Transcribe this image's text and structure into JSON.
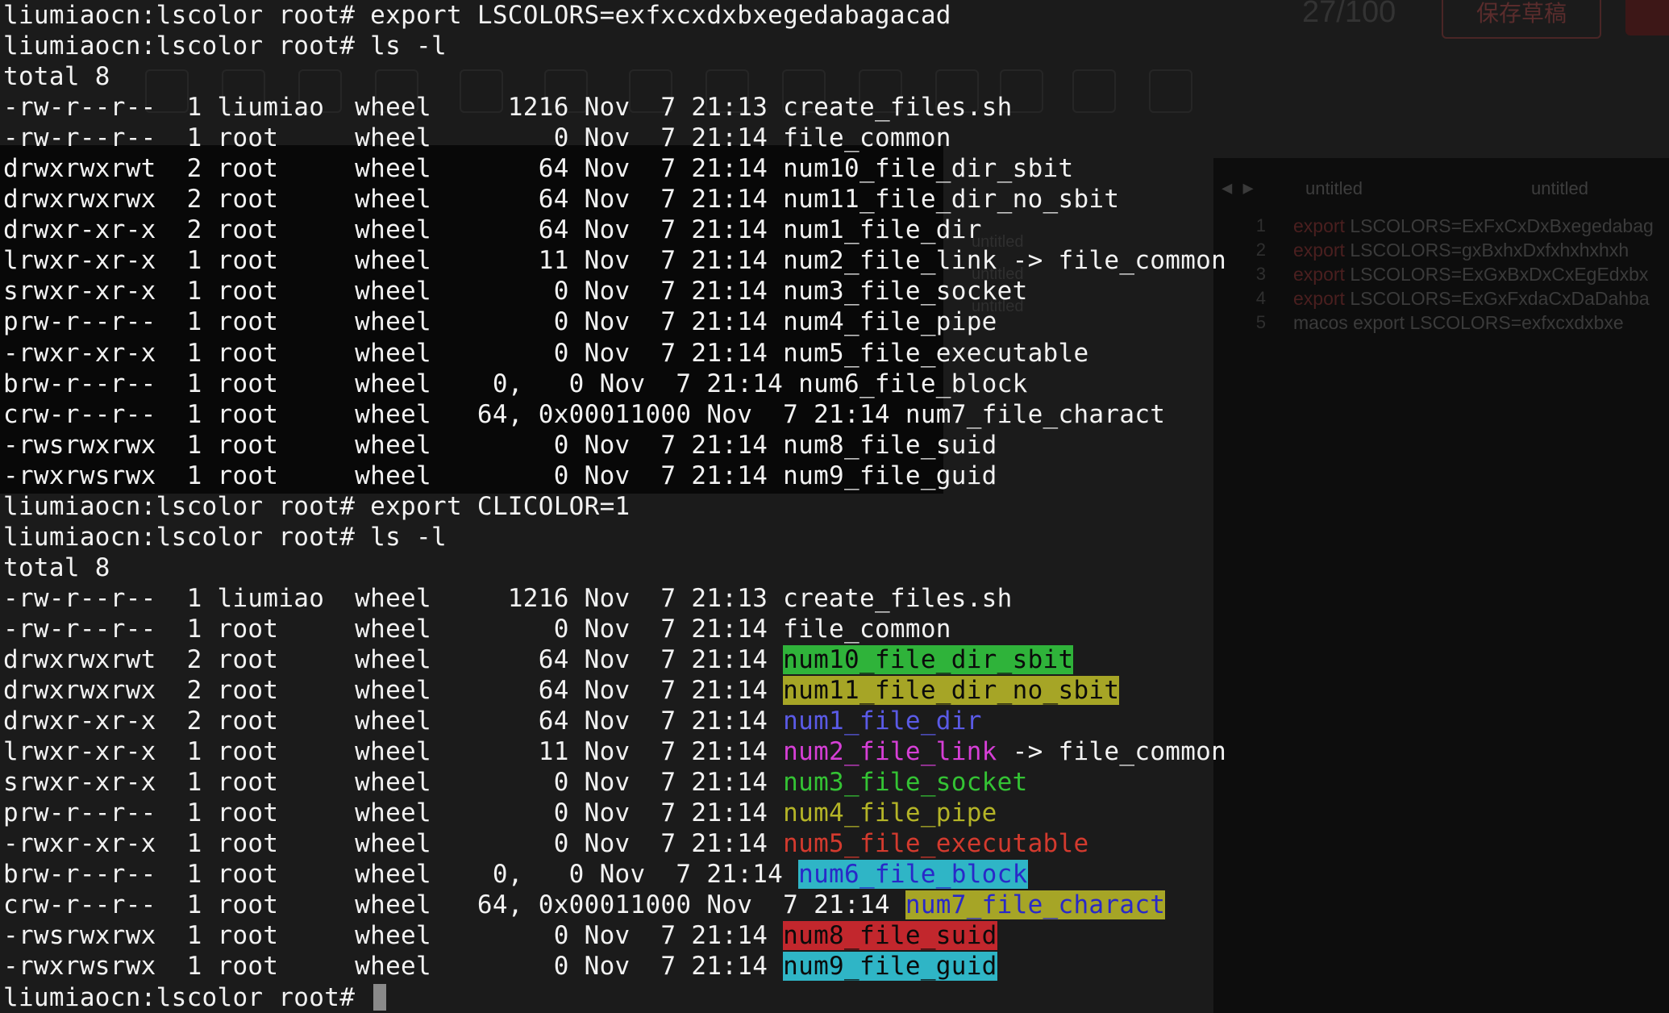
{
  "background_window": {
    "counter": "27/100",
    "save_draft_button": "保存草稿",
    "editor_tabs": [
      "untitled",
      "untitled"
    ],
    "sidebar_items": [
      "untitled",
      "untitled",
      "untitled"
    ],
    "line_numbers": [
      "1",
      "2",
      "3",
      "4",
      "5"
    ],
    "code_lines": [
      {
        "kw": "export",
        "rest": " LSCOLORS=ExFxCxDxBxegedabag"
      },
      {
        "kw": "export",
        "rest": " LSCOLORS=gxBxhxDxfxhxhxhxh"
      },
      {
        "kw": "export",
        "rest": " LSCOLORS=ExGxBxDxCxEgEdxbx"
      },
      {
        "kw": "export",
        "rest": " LSCOLORS=ExGxFxdaCxDaDahba"
      },
      {
        "kw": "",
        "rest": "macos export LSCOLORS=exfxcxdxbxe"
      }
    ]
  },
  "colors": {
    "default_text": "#f2f2f2",
    "dir_sbit_bg": "#2fb33a",
    "dir_no_sbit_bg": "#a6a526",
    "dir_fg": "#5a5ae6",
    "link_fg": "#d63fd6",
    "socket_fg": "#34c334",
    "pipe_fg": "#b4b427",
    "exec_fg": "#d33a2e",
    "block_bg": "#2fb5c6",
    "block_fg": "#2929c8",
    "char_bg": "#a6a526",
    "char_fg": "#2929c8",
    "suid_bg": "#c2272d",
    "suid_fg": "#0b0b0b",
    "guid_bg": "#2fb5c6",
    "guid_fg": "#0b0b0b"
  },
  "terminal": {
    "lines": [
      {
        "text": "liumiaocn:lscolor root# export LSCOLORS=exfxcxdxbxegedabagacad"
      },
      {
        "text": "liumiaocn:lscolor root# ls -l"
      },
      {
        "text": "total 8"
      },
      {
        "text": "-rw-r--r--  1 liumiao  wheel     1216 Nov  7 21:13 ",
        "file": "create_files.sh"
      },
      {
        "text": "-rw-r--r--  1 root     wheel        0 Nov  7 21:14 ",
        "file": "file_common"
      },
      {
        "text": "drwxrwxrwt  2 root     wheel       64 Nov  7 21:14 ",
        "file": "num10_file_dir_sbit"
      },
      {
        "text": "drwxrwxrwx  2 root     wheel       64 Nov  7 21:14 ",
        "file": "num11_file_dir_no_sbit"
      },
      {
        "text": "drwxr-xr-x  2 root     wheel       64 Nov  7 21:14 ",
        "file": "num1_file_dir"
      },
      {
        "text": "lrwxr-xr-x  1 root     wheel       11 Nov  7 21:14 ",
        "file": "num2_file_link",
        "suffix": " -> file_common"
      },
      {
        "text": "srwxr-xr-x  1 root     wheel        0 Nov  7 21:14 ",
        "file": "num3_file_socket"
      },
      {
        "text": "prw-r--r--  1 root     wheel        0 Nov  7 21:14 ",
        "file": "num4_file_pipe"
      },
      {
        "text": "-rwxr-xr-x  1 root     wheel        0 Nov  7 21:14 ",
        "file": "num5_file_executable"
      },
      {
        "text": "brw-r--r--  1 root     wheel    0,   0 Nov  7 21:14 ",
        "file": "num6_file_block"
      },
      {
        "text": "crw-r--r--  1 root     wheel   64, 0x00011000 Nov  7 21:14 ",
        "file": "num7_file_charact"
      },
      {
        "text": "-rwsrwxrwx  1 root     wheel        0 Nov  7 21:14 ",
        "file": "num8_file_suid"
      },
      {
        "text": "-rwxrwsrwx  1 root     wheel        0 Nov  7 21:14 ",
        "file": "num9_file_guid"
      },
      {
        "text": "liumiaocn:lscolor root# export CLICOLOR=1"
      },
      {
        "text": "liumiaocn:lscolor root# ls -l"
      },
      {
        "text": "total 8"
      },
      {
        "text": "-rw-r--r--  1 liumiao  wheel     1216 Nov  7 21:13 ",
        "file": "create_files.sh"
      },
      {
        "text": "-rw-r--r--  1 root     wheel        0 Nov  7 21:14 ",
        "file": "file_common"
      },
      {
        "text": "drwxrwxrwt  2 root     wheel       64 Nov  7 21:14 ",
        "file": "num10_file_dir_sbit",
        "style": "dir_sbit"
      },
      {
        "text": "drwxrwxrwx  2 root     wheel       64 Nov  7 21:14 ",
        "file": "num11_file_dir_no_sbit",
        "style": "dir_no_sbit"
      },
      {
        "text": "drwxr-xr-x  2 root     wheel       64 Nov  7 21:14 ",
        "file": "num1_file_dir",
        "style": "dir"
      },
      {
        "text": "lrwxr-xr-x  1 root     wheel       11 Nov  7 21:14 ",
        "file": "num2_file_link",
        "suffix": " -> file_common",
        "style": "link"
      },
      {
        "text": "srwxr-xr-x  1 root     wheel        0 Nov  7 21:14 ",
        "file": "num3_file_socket",
        "style": "socket"
      },
      {
        "text": "prw-r--r--  1 root     wheel        0 Nov  7 21:14 ",
        "file": "num4_file_pipe",
        "style": "pipe"
      },
      {
        "text": "-rwxr-xr-x  1 root     wheel        0 Nov  7 21:14 ",
        "file": "num5_file_executable",
        "style": "exec"
      },
      {
        "text": "brw-r--r--  1 root     wheel    0,   0 Nov  7 21:14 ",
        "file": "num6_file_block",
        "style": "block"
      },
      {
        "text": "crw-r--r--  1 root     wheel   64, 0x00011000 Nov  7 21:14 ",
        "file": "num7_file_charact",
        "style": "char"
      },
      {
        "text": "-rwsrwxrwx  1 root     wheel        0 Nov  7 21:14 ",
        "file": "num8_file_suid",
        "style": "suid"
      },
      {
        "text": "-rwxrwsrwx  1 root     wheel        0 Nov  7 21:14 ",
        "file": "num9_file_guid",
        "style": "guid"
      },
      {
        "text": "liumiaocn:lscolor root# ",
        "cursor": true
      }
    ]
  }
}
